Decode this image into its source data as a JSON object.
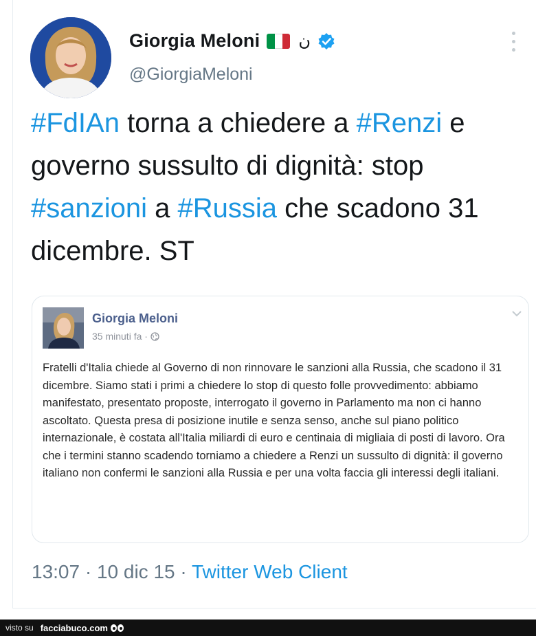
{
  "tweet": {
    "author_name": "Giorgia Meloni",
    "nun_symbol": "ن",
    "handle": "@GiorgiaMeloni",
    "text_segments": [
      {
        "text": "#FdIAn",
        "hashtag": true
      },
      {
        "text": " torna a chiedere a ",
        "hashtag": false
      },
      {
        "text": "#Renzi",
        "hashtag": true
      },
      {
        "text": " e governo sussulto di dignità: stop ",
        "hashtag": false
      },
      {
        "text": "#sanzioni",
        "hashtag": true
      },
      {
        "text": " a ",
        "hashtag": false
      },
      {
        "text": "#Russia",
        "hashtag": true
      },
      {
        "text": " che scadono 31 dicembre. ST",
        "hashtag": false
      }
    ],
    "time": "13:07",
    "date": "10 dic 15",
    "separator": "·",
    "client": "Twitter Web Client"
  },
  "quoted_post": {
    "author_name": "Giorgia Meloni",
    "time_ago": "35 minuti fa ·",
    "body": "Fratelli d'Italia chiede al Governo di non rinnovare le sanzioni alla Russia, che scadono il 31 dicembre. Siamo stati i primi a chiedere lo stop di questo folle provvedimento: abbiamo manifestato, presentato proposte, interrogato il governo in Parlamento ma non ci hanno ascoltato. Questa presa di posizione inutile e senza senso, anche sul piano politico internazionale, è costata all'Italia miliardi di euro e centinaia di migliaia di posti di lavoro. Ora che i termini stanno scadendo torniamo a chiedere a Renzi un sussulto di dignità: il governo italiano non confermi le sanzioni alla Russia e per una volta faccia gli interessi degli italiani."
  },
  "footer": {
    "visto_su": "visto su",
    "site": "facciabuco.com"
  },
  "icons": {
    "flag": "italy-flag-icon",
    "verified": "verified-badge-icon",
    "more": "more-options-icon",
    "globe": "globe-icon",
    "chevron": "chevron-down-icon"
  },
  "colors": {
    "hashtag": "#1b95e0",
    "text": "#14171a",
    "secondary": "#657786",
    "verified": "#1da1f2",
    "flag_green": "#009246",
    "flag_white": "#ffffff",
    "flag_red": "#ce2b37"
  }
}
